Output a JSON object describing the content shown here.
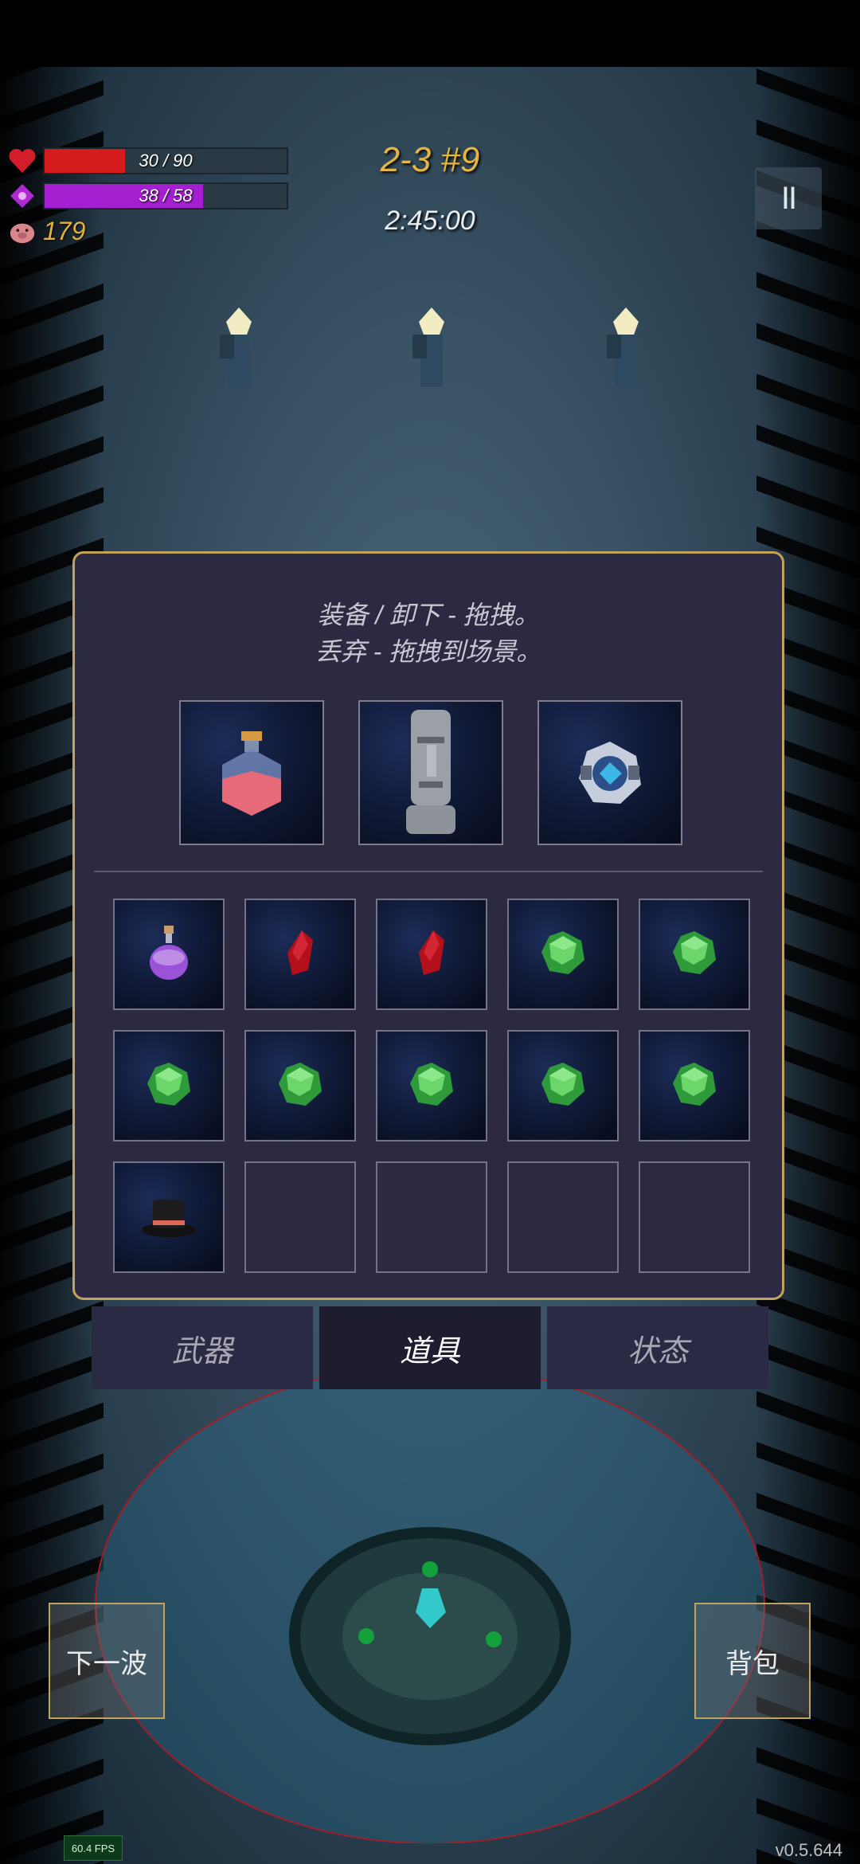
{
  "hud": {
    "health_text": "30 / 90",
    "health_fraction": 0.333,
    "health_color": "#d41c1c",
    "mana_text": "38 / 58",
    "mana_fraction": 0.655,
    "mana_color": "#a31fcf",
    "coins": "179",
    "stage": "2-3 #9",
    "timer": "2:45:00",
    "pause_label": "II"
  },
  "inventory": {
    "hint_line1": "装备 / 卸下 - 拖拽。",
    "hint_line2": "丢弃 - 拖拽到场景。",
    "equipped": [
      {
        "icon": "pink-potion-flask-icon"
      },
      {
        "icon": "moai-head-statue-icon"
      },
      {
        "icon": "blue-orb-gear-icon"
      }
    ],
    "rows": [
      [
        "purple-potion-icon",
        "red-crystal-icon",
        "red-crystal-icon",
        "green-gem-icon",
        "green-gem-icon"
      ],
      [
        "green-gem-icon",
        "green-gem-icon",
        "green-gem-icon",
        "green-gem-icon",
        "green-gem-icon"
      ],
      [
        "top-hat-icon",
        "",
        "",
        "",
        ""
      ]
    ]
  },
  "tabs": [
    {
      "label": "武器",
      "active": false
    },
    {
      "label": "道具",
      "active": true
    },
    {
      "label": "状态",
      "active": false
    }
  ],
  "buttons": {
    "next_wave": "下一波",
    "backpack": "背包"
  },
  "fps": "60.4 FPS",
  "version": "v0.5.644",
  "colors": {
    "panel_bg": "#2c2a43",
    "panel_border": "#c2a35c",
    "stage_gold": "#e6b440",
    "gem_green": "#3fbf3f",
    "crystal_red": "#b3101c"
  }
}
